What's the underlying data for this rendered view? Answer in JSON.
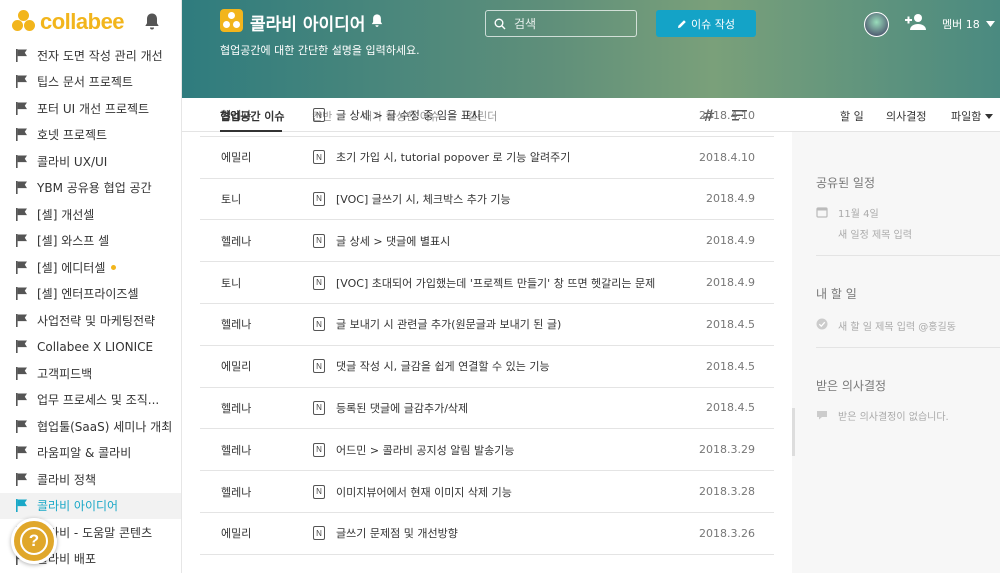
{
  "app": {
    "logo_text": "collabee"
  },
  "sidebar": {
    "items": [
      {
        "label": "전자 도면 작성 관리 개선"
      },
      {
        "label": "팁스 문서 프로젝트"
      },
      {
        "label": "포터 UI 개선 프로젝트"
      },
      {
        "label": "호넷 프로젝트"
      },
      {
        "label": "콜라비 UX/UI"
      },
      {
        "label": "YBM 공유용 협업 공간"
      },
      {
        "label": "[셀] 개선셀"
      },
      {
        "label": "[셀] 와스프 셀"
      },
      {
        "label": "[셀] 에디터셀",
        "dot": true
      },
      {
        "label": "[셀] 엔터프라이즈셀"
      },
      {
        "label": "사업전략 및 마케팅전략"
      },
      {
        "label": "Collabee X LIONICE"
      },
      {
        "label": "고객피드백"
      },
      {
        "label": "업무 프로세스 및 조직..."
      },
      {
        "label": "협업툴(SaaS) 세미나 개최"
      },
      {
        "label": "라움피알 & 콜라비"
      },
      {
        "label": "콜라비 정책"
      },
      {
        "label": "콜라비 아이디어",
        "active": true
      },
      {
        "label": "콜라비 - 도움말 콘텐츠"
      },
      {
        "label": "콜라비 배포"
      }
    ],
    "help_label": "?"
  },
  "header": {
    "workspace_title": "콜라비 아이디어",
    "description": "협업공간에 대한 간단한 설명을 입력하세요.",
    "search_placeholder": "검색",
    "new_issue_label": "이슈 작성",
    "members_label": "멤버 18"
  },
  "tabs": {
    "items": [
      "협업공간 이슈",
      "칸반",
      "내가 작성한 이슈",
      "캘린더"
    ],
    "hash": "#",
    "right": [
      "할 일",
      "의사결정",
      "파일함"
    ]
  },
  "issues": [
    {
      "author": "헬레나",
      "title": "글 상세 > 글 수정 중 임을 표시",
      "date": "2018.4.10"
    },
    {
      "author": "에밀리",
      "title": "초기 가입 시, tutorial popover 로 기능 알려주기",
      "date": "2018.4.10"
    },
    {
      "author": "토니",
      "title": "[VOC] 글쓰기 시, 체크박스 추가 기능",
      "date": "2018.4.9"
    },
    {
      "author": "헬레나",
      "title": "글 상세 > 댓글에 별표시",
      "date": "2018.4.9"
    },
    {
      "author": "토니",
      "title": "[VOC] 초대되어 가입했는데 '프로젝트 만들기' 창 뜨면 헷갈리는 문제",
      "date": "2018.4.9"
    },
    {
      "author": "헬레나",
      "title": "글 보내기 시 관련글 추가(원문글과 보내기 된 글)",
      "date": "2018.4.5"
    },
    {
      "author": "에밀리",
      "title": "댓글 작성 시, 글감을 쉽게 연결할 수 있는 기능",
      "date": "2018.4.5"
    },
    {
      "author": "헬레나",
      "title": "등록된 댓글에 글감추가/삭제",
      "date": "2018.4.5"
    },
    {
      "author": "헬레나",
      "title": "어드민 > 콜라비 공지성 알림 발송기능",
      "date": "2018.3.29"
    },
    {
      "author": "헬레나",
      "title": "이미지뷰어에서 현재 이미지 삭제 기능",
      "date": "2018.3.28"
    },
    {
      "author": "에밀리",
      "title": "글쓰기 문제점 및 개선방향",
      "date": "2018.3.26"
    }
  ],
  "issue_icon_letter": "N",
  "right_panel": {
    "shared_schedule_title": "공유된 일정",
    "schedule_date": "11월 4일",
    "schedule_placeholder": "새 일정 제목 입력",
    "todo_title": "내 할 일",
    "todo_placeholder": "새 할 일 제목 입력 @홍길동",
    "decisions_title": "받은 의사결정",
    "decisions_empty": "받은 의사결정이 없습니다."
  },
  "colors": {
    "accent": "#14a3c7",
    "brand": "#f2b51c",
    "active_text": "#1aa8c7"
  }
}
